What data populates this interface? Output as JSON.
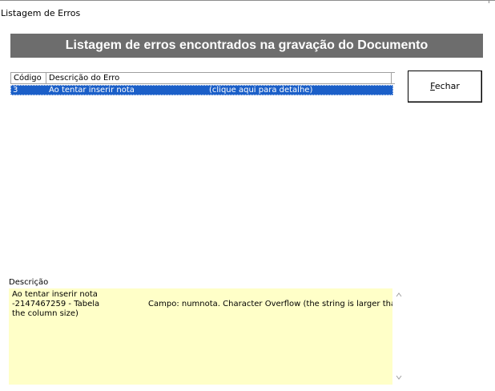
{
  "window": {
    "title": "Listagem de Erros"
  },
  "header": {
    "title": "Listagem de erros encontrados na gravação do Documento"
  },
  "grid": {
    "columns": [
      "Código",
      "Descrição do Erro"
    ],
    "rows": [
      {
        "codigo": "3",
        "descricao": "Ao tentar inserir nota",
        "detalhe": "(clique aqui para detalhe)",
        "selected": true
      }
    ]
  },
  "buttons": {
    "fechar_mnemonic": "F",
    "fechar_rest": "echar"
  },
  "descricao": {
    "label": "Descrição",
    "line1": "Ao tentar inserir nota",
    "line2_left": "-2147467259 - Tabela",
    "line2_right": "Campo: numnota. Character Overflow (the string is larger than",
    "line3": "the column size)"
  },
  "colors": {
    "header_bg": "#6d6d6d",
    "selection": "#1b5fc8",
    "description_bg": "#ffffc8"
  },
  "icons": {
    "scroll_up": "chevron-up-icon",
    "scroll_down": "chevron-down-icon"
  }
}
